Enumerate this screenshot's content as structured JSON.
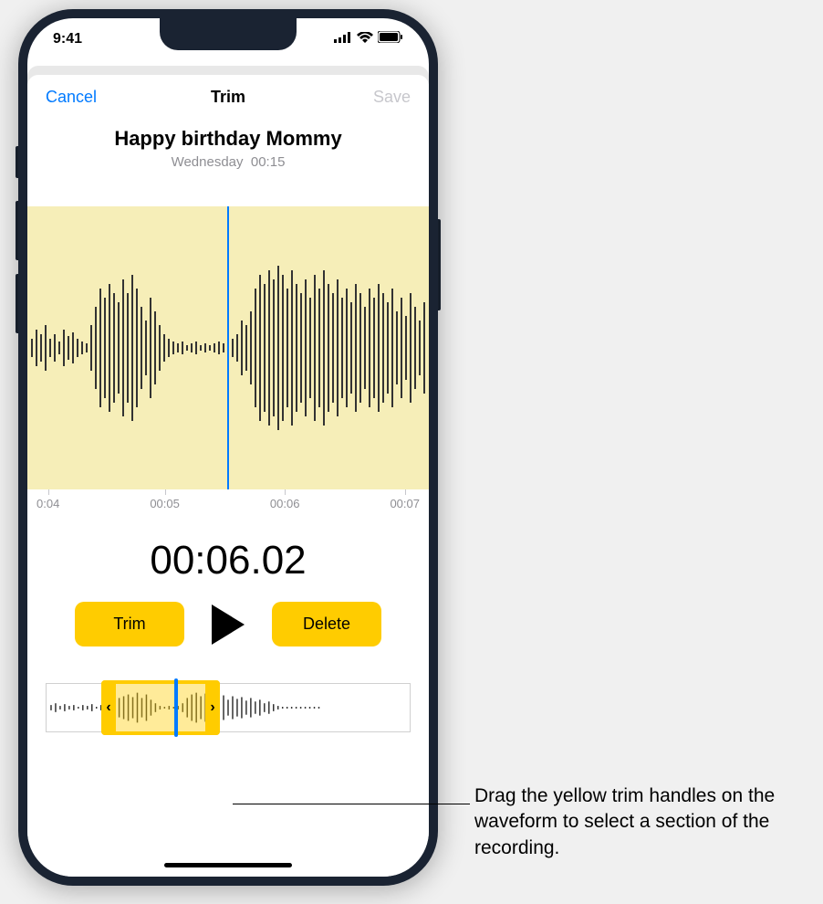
{
  "status": {
    "time": "9:41",
    "signal": "●●●●",
    "wifi": "wifi",
    "battery": "battery"
  },
  "nav": {
    "cancel": "Cancel",
    "title": "Trim",
    "save": "Save"
  },
  "recording": {
    "title": "Happy birthday Mommy",
    "day": "Wednesday",
    "duration": "00:15"
  },
  "timeline": {
    "ticks": [
      "0:04",
      "00:05",
      "00:06",
      "00:07"
    ],
    "current": "00:06.02"
  },
  "controls": {
    "trim": "Trim",
    "delete": "Delete"
  },
  "callout": "Drag the yellow trim handles on the waveform to select a section of the recording."
}
